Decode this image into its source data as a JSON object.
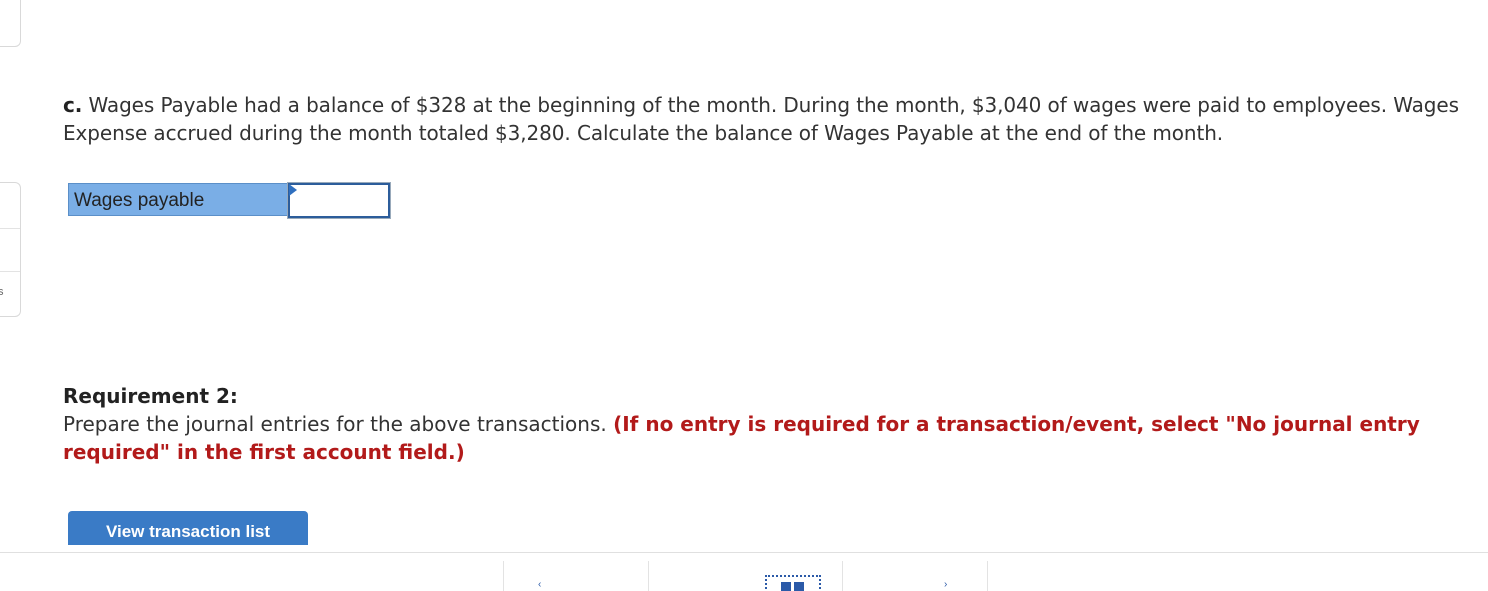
{
  "side": {
    "letter": "s"
  },
  "question": {
    "prefix": "c.",
    "text": " Wages Payable had a balance of $328 at the beginning of the month. During the month, $3,040 of wages were paid to employees. Wages Expense accrued during the month totaled $3,280. Calculate the balance of Wages Payable at the end of the month."
  },
  "answer": {
    "label": "Wages payable",
    "value": ""
  },
  "requirement": {
    "title": "Requirement 2:",
    "instruction": "Prepare the journal entries for the above transactions. ",
    "warning": "(If no entry is required for a transaction/event, select \"No journal entry required\" in the first account field.)"
  },
  "buttons": {
    "view_transaction_list": "View transaction list"
  },
  "colors": {
    "label_bg": "#7aaee6",
    "button_bg": "#3a7bc6",
    "warning": "#b21a1a"
  }
}
